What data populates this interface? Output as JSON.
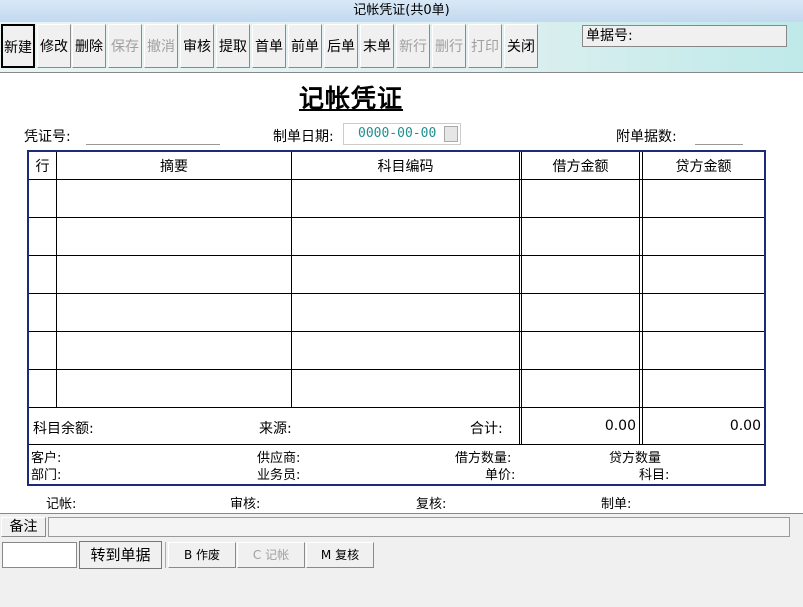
{
  "window": {
    "title": "记帐凭证(共0单)"
  },
  "toolbar": {
    "buttons": [
      {
        "label": "新建",
        "enabled": true
      },
      {
        "label": "修改",
        "enabled": true
      },
      {
        "label": "删除",
        "enabled": true
      },
      {
        "label": "保存",
        "enabled": false
      },
      {
        "label": "撤消",
        "enabled": false
      },
      {
        "label": "审核",
        "enabled": true
      },
      {
        "label": "提取",
        "enabled": true
      },
      {
        "label": "首单",
        "enabled": true
      },
      {
        "label": "前单",
        "enabled": true
      },
      {
        "label": "后单",
        "enabled": true
      },
      {
        "label": "末单",
        "enabled": true
      },
      {
        "label": "新行",
        "enabled": false
      },
      {
        "label": "删行",
        "enabled": false
      },
      {
        "label": "打印",
        "enabled": false
      },
      {
        "label": "关闭",
        "enabled": true
      }
    ],
    "doc_number_label": "单据号:"
  },
  "voucher": {
    "title": "记帐凭证",
    "voucher_no_label": "凭证号:",
    "date_label": "制单日期:",
    "date_value": "0000-00-00",
    "attachments_label": "附单据数:",
    "columns": [
      "行",
      "摘要",
      "科目编码",
      "借方金额",
      "贷方金额"
    ],
    "summary": {
      "balance_label": "科目余额:",
      "source_label": "来源:",
      "total_label": "合计:",
      "debit_total": "0.00",
      "credit_total": "0.00"
    },
    "info": {
      "customer_label": "客户:",
      "supplier_label": "供应商:",
      "debit_qty_label": "借方数量:",
      "credit_qty_label": "贷方数量",
      "dept_label": "部门:",
      "salesman_label": "业务员:",
      "unit_price_label": "单价:",
      "subject_label": "科目:"
    },
    "signatures": {
      "bookkeeper_label": "记帐:",
      "reviewer_label": "审核:",
      "rechecker_label": "复核:",
      "preparer_label": "制单:"
    }
  },
  "remark": {
    "label": "备注"
  },
  "bottom": {
    "jump_label": "转到单据",
    "void_label": "B 作废",
    "post_label": "C 记帐",
    "recheck_label": "M 复核"
  },
  "colors": {
    "grid_border": "#1c2a78",
    "date_text": "#1f8f8f"
  }
}
